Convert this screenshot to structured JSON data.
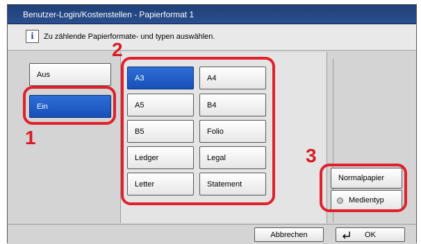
{
  "window": {
    "title": "Benutzer-Login/Kostenstellen - Papierformat 1"
  },
  "message": {
    "text": "Zu zählende Papierformate- und typen auswählen."
  },
  "toggle": {
    "off_label": "Aus",
    "on_label": "Ein",
    "selected": "Ein"
  },
  "paper_sizes": [
    "A3",
    "A4",
    "A5",
    "B4",
    "B5",
    "Folio",
    "Ledger",
    "Legal",
    "Letter",
    "Statement"
  ],
  "paper_selected": "A3",
  "media": {
    "normal_label": "Normalpapier",
    "type_label": "Medientyp"
  },
  "footer": {
    "cancel_label": "Abbrechen",
    "ok_label": "OK",
    "ok_icon": "enter-arrow-icon"
  },
  "callouts": [
    "1",
    "2",
    "3"
  ],
  "colors": {
    "accent": "#1a56c0",
    "highlight": "#e0202a",
    "title_bg": "#1f3f77"
  }
}
